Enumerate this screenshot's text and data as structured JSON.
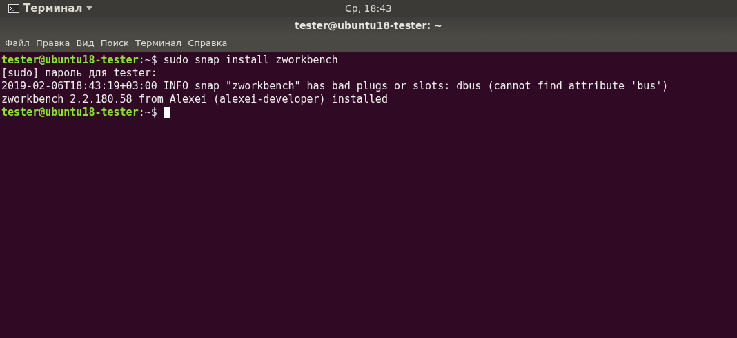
{
  "top_bar": {
    "app_menu": "Терминал",
    "clock": "Ср, 18:43"
  },
  "window": {
    "title": "tester@ubuntu18-tester: ~"
  },
  "menu": [
    "Файл",
    "Правка",
    "Вид",
    "Поиск",
    "Терминал",
    "Справка"
  ],
  "terminal": {
    "lines": [
      {
        "kind": "prompt",
        "host": "tester@ubuntu18-tester",
        "path": ":~$",
        "command": "sudo snap install zworkbench",
        "cursor": false
      },
      {
        "kind": "output",
        "text": "[sudo] пароль для tester:"
      },
      {
        "kind": "output",
        "text": "2019-02-06T18:43:19+03:00 INFO snap \"zworkbench\" has bad plugs or slots: dbus (cannot find attribute 'bus')"
      },
      {
        "kind": "output",
        "text": "zworkbench 2.2.180.58 from Alexei (alexei-developer) installed"
      },
      {
        "kind": "prompt",
        "host": "tester@ubuntu18-tester",
        "path": ":~$",
        "cursor": true
      }
    ]
  }
}
